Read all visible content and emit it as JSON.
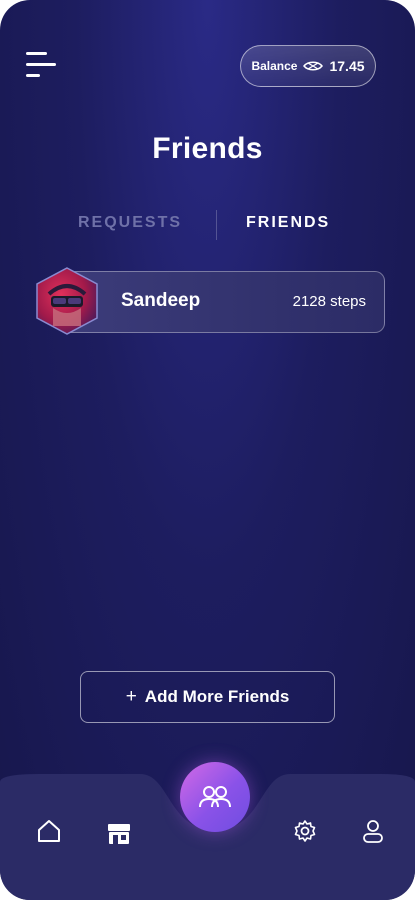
{
  "header": {
    "menu_icon": "menu-icon",
    "balance": {
      "label": "Balance",
      "icon": "currency-icon",
      "value": "17.45"
    }
  },
  "page": {
    "title": "Friends"
  },
  "tabs": [
    {
      "label": "REQUESTS",
      "active": false
    },
    {
      "label": "FRIENDS",
      "active": true
    }
  ],
  "friends": [
    {
      "name": "Sandeep",
      "steps": "2128 steps",
      "avatar": "avatar-image"
    }
  ],
  "actions": {
    "add_friends_label": "Add More Friends",
    "add_icon": "plus-icon"
  },
  "nav": {
    "items": [
      {
        "icon": "home-icon"
      },
      {
        "icon": "store-icon"
      },
      {
        "icon": "friends-icon",
        "active": true
      },
      {
        "icon": "gear-icon"
      },
      {
        "icon": "profile-icon"
      }
    ]
  },
  "colors": {
    "background": "#1d1d5f",
    "accent_gradient_start": "#d36ae6",
    "accent_gradient_end": "#6f4de0",
    "inactive_tab": "#6f71a8",
    "navbar": "#2a2a64"
  }
}
